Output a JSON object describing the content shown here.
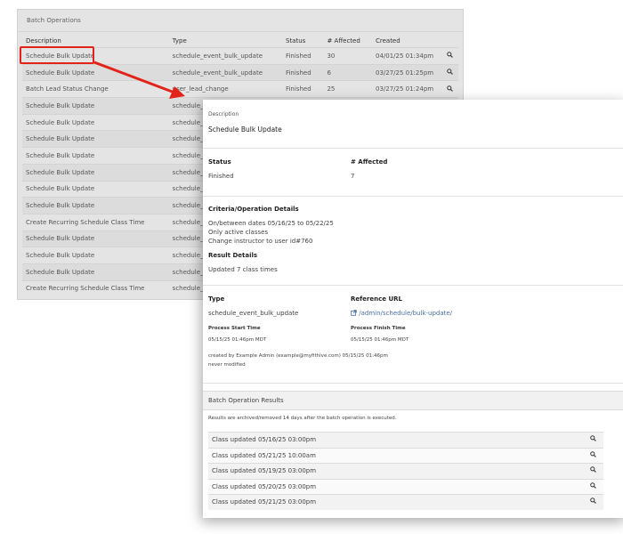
{
  "list": {
    "title": "Batch Operations",
    "columns": [
      "Description",
      "Type",
      "Status",
      "# Affected",
      "Created"
    ],
    "rows": [
      {
        "description": "Schedule Bulk Update",
        "type": "schedule_event_bulk_update",
        "status": "Finished",
        "affected": "30",
        "created": "04/01/25 01:34pm"
      },
      {
        "description": "Schedule Bulk Update",
        "type": "schedule_event_bulk_update",
        "status": "Finished",
        "affected": "6",
        "created": "03/27/25 01:25pm"
      },
      {
        "description": "Batch Lead Status Change",
        "type": "user_lead_change",
        "status": "Finished",
        "affected": "25",
        "created": "03/27/25 01:24pm"
      },
      {
        "description": "Schedule Bulk Update",
        "type": "schedule_",
        "status": "",
        "affected": "",
        "created": ""
      },
      {
        "description": "Schedule Bulk Update",
        "type": "schedule_",
        "status": "",
        "affected": "",
        "created": ""
      },
      {
        "description": "Schedule Bulk Update",
        "type": "schedule_",
        "status": "",
        "affected": "",
        "created": ""
      },
      {
        "description": "Schedule Bulk Update",
        "type": "schedule_",
        "status": "",
        "affected": "",
        "created": ""
      },
      {
        "description": "Schedule Bulk Update",
        "type": "schedule_",
        "status": "",
        "affected": "",
        "created": ""
      },
      {
        "description": "Schedule Bulk Update",
        "type": "schedule_",
        "status": "",
        "affected": "",
        "created": ""
      },
      {
        "description": "Schedule Bulk Update",
        "type": "schedule_",
        "status": "",
        "affected": "",
        "created": ""
      },
      {
        "description": "Create Recurring Schedule Class Time",
        "type": "schedule_",
        "status": "",
        "affected": "",
        "created": ""
      },
      {
        "description": "Schedule Bulk Update",
        "type": "schedule_",
        "status": "",
        "affected": "",
        "created": ""
      },
      {
        "description": "Schedule Bulk Update",
        "type": "schedule_",
        "status": "",
        "affected": "",
        "created": ""
      },
      {
        "description": "Schedule Bulk Update",
        "type": "schedule_",
        "status": "",
        "affected": "",
        "created": ""
      },
      {
        "description": "Create Recurring Schedule Class Time",
        "type": "schedule_",
        "status": "",
        "affected": "",
        "created": ""
      }
    ]
  },
  "detail": {
    "description_label": "Description",
    "description_value": "Schedule Bulk Update",
    "status_label": "Status",
    "status_value": "Finished",
    "affected_label": "# Affected",
    "affected_value": "7",
    "criteria_label": "Criteria/Operation Details",
    "criteria_lines": [
      "On/between dates 05/16/25 to 05/22/25",
      "Only active classes",
      "Change instructor to user id#760"
    ],
    "result_label": "Result Details",
    "result_value": "Updated 7 class times",
    "type_label": "Type",
    "type_value": "schedule_event_bulk_update",
    "ref_label": "Reference URL",
    "ref_value": "/admin/schedule/bulk-update/",
    "start_label": "Process Start Time",
    "start_value": "05/15/25 01:46pm MDT",
    "finish_label": "Process Finish Time",
    "finish_value": "05/15/25 01:46pm MDT",
    "created_by": "created by Example Admin (example@myfithive.com) 05/15/25 01:46pm",
    "modified": "never modified"
  },
  "results": {
    "title": "Batch Operation Results",
    "note": "Results are archived/removed 14 days after the batch operation is executed.",
    "rows": [
      "Class updated 05/16/25 03:00pm",
      "Class updated 05/21/25 10:00am",
      "Class updated 05/19/25 03:00pm",
      "Class updated 05/20/25 03:00pm",
      "Class updated 05/21/25 03:00pm"
    ]
  },
  "icons": {
    "view": "magnifier-icon",
    "external": "external-link-icon"
  },
  "colors": {
    "highlight": "#e2231a",
    "link": "#4a6fa5"
  }
}
